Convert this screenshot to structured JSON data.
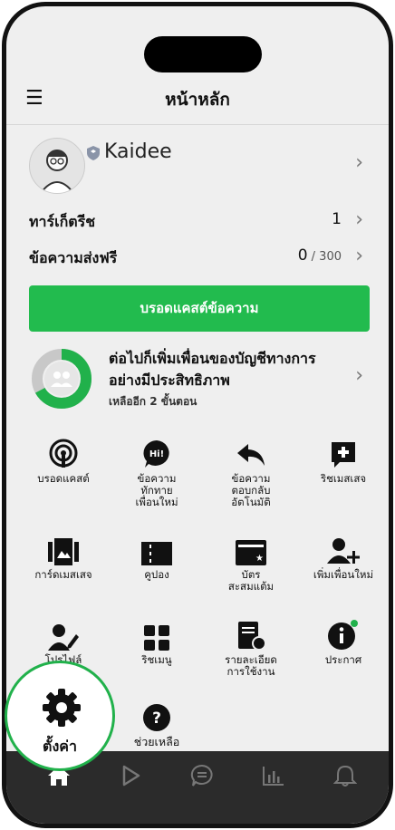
{
  "header": {
    "title": "หน้าหลัก",
    "menu_icon": "hamburger-menu-icon"
  },
  "profile": {
    "name": "Kaidee"
  },
  "rows": [
    {
      "label": "ทาร์เก็ตรีช",
      "value": "1",
      "max": ""
    },
    {
      "label": "ข้อความส่งฟรี",
      "value": "0",
      "max": " / 300"
    }
  ],
  "broadcast_button": "บรอดแคสต์ข้อความ",
  "progress": {
    "title": "ต่อไปก็เพิ่มเพื่อนของบัญชีทางการอย่างมีประสิทธิภาพ",
    "subtitle": "เหลืออีก 2 ขั้นตอน",
    "fraction": 0.67,
    "color": "#21b14b"
  },
  "tiles": [
    {
      "label": "บรอดแคสต์",
      "icon": "broadcast-icon"
    },
    {
      "label": "ข้อความ\nทักทาย\nเพื่อนใหม่",
      "icon": "greeting-message-icon"
    },
    {
      "label": "ข้อความ\nตอบกลับ\nอัตโนมัติ",
      "icon": "auto-reply-icon"
    },
    {
      "label": "ริชเมสเสจ",
      "icon": "rich-message-icon"
    },
    {
      "label": "การ์ดเมสเสจ",
      "icon": "card-message-icon"
    },
    {
      "label": "คูปอง",
      "icon": "coupon-icon"
    },
    {
      "label": "บัตร\nสะสมแต้ม",
      "icon": "reward-card-icon"
    },
    {
      "label": "เพิ่มเพื่อนใหม่",
      "icon": "add-friend-icon"
    },
    {
      "label": "โปรไฟล์",
      "icon": "profile-icon"
    },
    {
      "label": "ริชเมนู",
      "icon": "rich-menu-icon"
    },
    {
      "label": "รายละเอียด\nการใช้งาน",
      "icon": "usage-details-icon"
    },
    {
      "label": "ประกาศ",
      "icon": "notice-icon"
    },
    {
      "label": "ตั้งค่า",
      "icon": "settings-gear-icon"
    },
    {
      "label": "ช่วยเหลือ",
      "icon": "help-icon"
    }
  ],
  "bottom_nav": [
    "home-icon",
    "play-icon",
    "chat-icon",
    "insight-chart-icon",
    "bell-icon"
  ],
  "colors": {
    "accent": "#22bb4e",
    "nav_bg": "#2b2b2b"
  }
}
